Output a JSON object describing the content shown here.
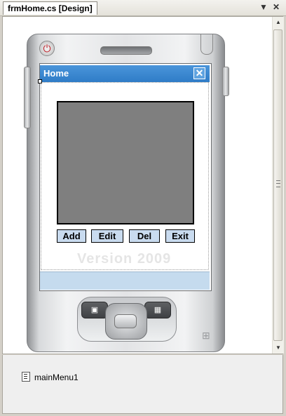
{
  "document_tab": {
    "title": "frmHome.cs [Design]",
    "dropdown_icon": "chevron-down-icon",
    "close_icon": "close-icon"
  },
  "device": {
    "power_icon": "power-icon",
    "windows_logo": "windows-logo-icon"
  },
  "form": {
    "title": "Home",
    "close_icon": "close-icon",
    "buttons": {
      "add": "Add",
      "edit": "Edit",
      "del": "Del",
      "exit": "Exit"
    },
    "watermark": "Version 2009"
  },
  "component_tray": {
    "items": [
      {
        "label": "mainMenu1",
        "icon": "menu-component-icon"
      }
    ]
  },
  "colors": {
    "titlebar": "#3a88d2",
    "picturebox": "#7f7f7f",
    "button_bg": "#c9dbef",
    "menubar": "#c5dbee"
  }
}
